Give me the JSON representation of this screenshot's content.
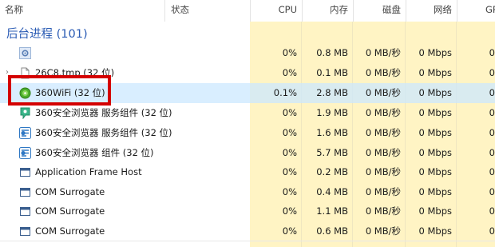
{
  "header": {
    "name": "名称",
    "status": "状态",
    "cpu": "CPU",
    "memory": "内存",
    "disk": "磁盘",
    "network": "网络",
    "gpu": "GP"
  },
  "section": {
    "title": "后台进程 (101)"
  },
  "rows": [
    {
      "name": "",
      "icon": "gear-icon",
      "cpu": "0%",
      "mem": "0.8 MB",
      "disk": "0 MB/秒",
      "net": "0 Mbps",
      "gpu": "0"
    },
    {
      "name": "26C8.tmp (32 位)",
      "icon": "file-icon",
      "cpu": "0%",
      "mem": "0.1 MB",
      "disk": "0 MB/秒",
      "net": "0 Mbps",
      "gpu": "0"
    },
    {
      "name": "360WiFi (32 位)",
      "icon": "wifi-app-icon",
      "cpu": "0.1%",
      "mem": "2.8 MB",
      "disk": "0 MB/秒",
      "net": "0 Mbps",
      "gpu": "0"
    },
    {
      "name": "360安全浏览器 服务组件 (32 位)",
      "icon": "browser-service-icon",
      "cpu": "0%",
      "mem": "1.9 MB",
      "disk": "0 MB/秒",
      "net": "0 Mbps",
      "gpu": "0"
    },
    {
      "name": "360安全浏览器 服务组件 (32 位)",
      "icon": "browser-icon",
      "cpu": "0%",
      "mem": "1.6 MB",
      "disk": "0 MB/秒",
      "net": "0 Mbps",
      "gpu": "0"
    },
    {
      "name": "360安全浏览器 组件 (32 位)",
      "icon": "browser-icon",
      "cpu": "0%",
      "mem": "5.7 MB",
      "disk": "0 MB/秒",
      "net": "0 Mbps",
      "gpu": "0"
    },
    {
      "name": "Application Frame Host",
      "icon": "window-icon",
      "cpu": "0%",
      "mem": "0.2 MB",
      "disk": "0 MB/秒",
      "net": "0 Mbps",
      "gpu": "0"
    },
    {
      "name": "COM Surrogate",
      "icon": "window-icon",
      "cpu": "0%",
      "mem": "0.4 MB",
      "disk": "0 MB/秒",
      "net": "0 Mbps",
      "gpu": "0"
    },
    {
      "name": "COM Surrogate",
      "icon": "window-icon",
      "cpu": "0%",
      "mem": "1.1 MB",
      "disk": "0 MB/秒",
      "net": "0 Mbps",
      "gpu": "0"
    },
    {
      "name": "COM Surrogate",
      "icon": "window-icon",
      "cpu": "0%",
      "mem": "0.6 MB",
      "disk": "0 MB/秒",
      "net": "0 Mbps",
      "gpu": "0"
    }
  ],
  "colors": {
    "cpu_bg": "#fff4c4",
    "mem_bg": "#fff4c4",
    "disk_bg": "#fff4c4",
    "net_bg": "#fff4c4",
    "gpu_bg": "#fff4c4",
    "highlight": "#d40000",
    "section_title": "#2a5bb4"
  }
}
